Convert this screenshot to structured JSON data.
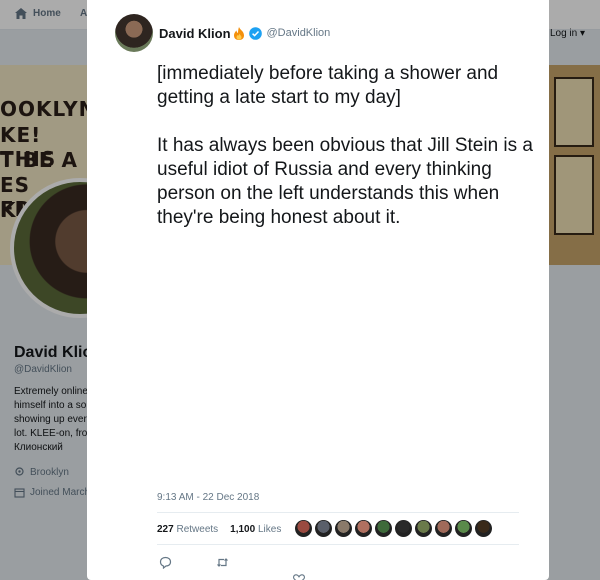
{
  "nav": {
    "home_label": "Home",
    "second_label_fragment": "A",
    "login_label": "Log in ▾"
  },
  "background_profile": {
    "banner_text_lines": [
      "OOKLYN'",
      "KE! THIS",
      "T BE A",
      "ES FROM",
      "K!"
    ],
    "name": "David Klio",
    "handle": "@DavidKlion",
    "bio_lines": [
      "Extremely online",
      "himself into a so",
      "showing up ever",
      "lot. KLEE-on, fro",
      "Клионский"
    ],
    "location": "Brooklyn",
    "joined": "Joined March"
  },
  "tweet": {
    "author_name": "David Klion",
    "author_handle": "@DavidKlion",
    "paragraphs": [
      "[immediately before taking a shower and getting a late start to my day]",
      "It has always been obvious that Jill Stein is a useful idiot of Russia and every thinking person on the left understands this when they're being honest about it."
    ],
    "timestamp": "9:13 AM - 22 Dec 2018",
    "retweets_count": "227",
    "retweets_label": "Retweets",
    "likes_count": "1,100",
    "likes_label": "Likes",
    "liker_avatar_colors": [
      "#9a4a40",
      "#5a5f6a",
      "#8a7a6a",
      "#b07060",
      "#3e6a3a",
      "#2a2a2a",
      "#6a7a4a",
      "#a06a5a",
      "#5a8a4a",
      "#3a2a1a"
    ]
  },
  "colors": {
    "verified": "#1da1f2",
    "text": "#14171a",
    "muted": "#657786"
  }
}
